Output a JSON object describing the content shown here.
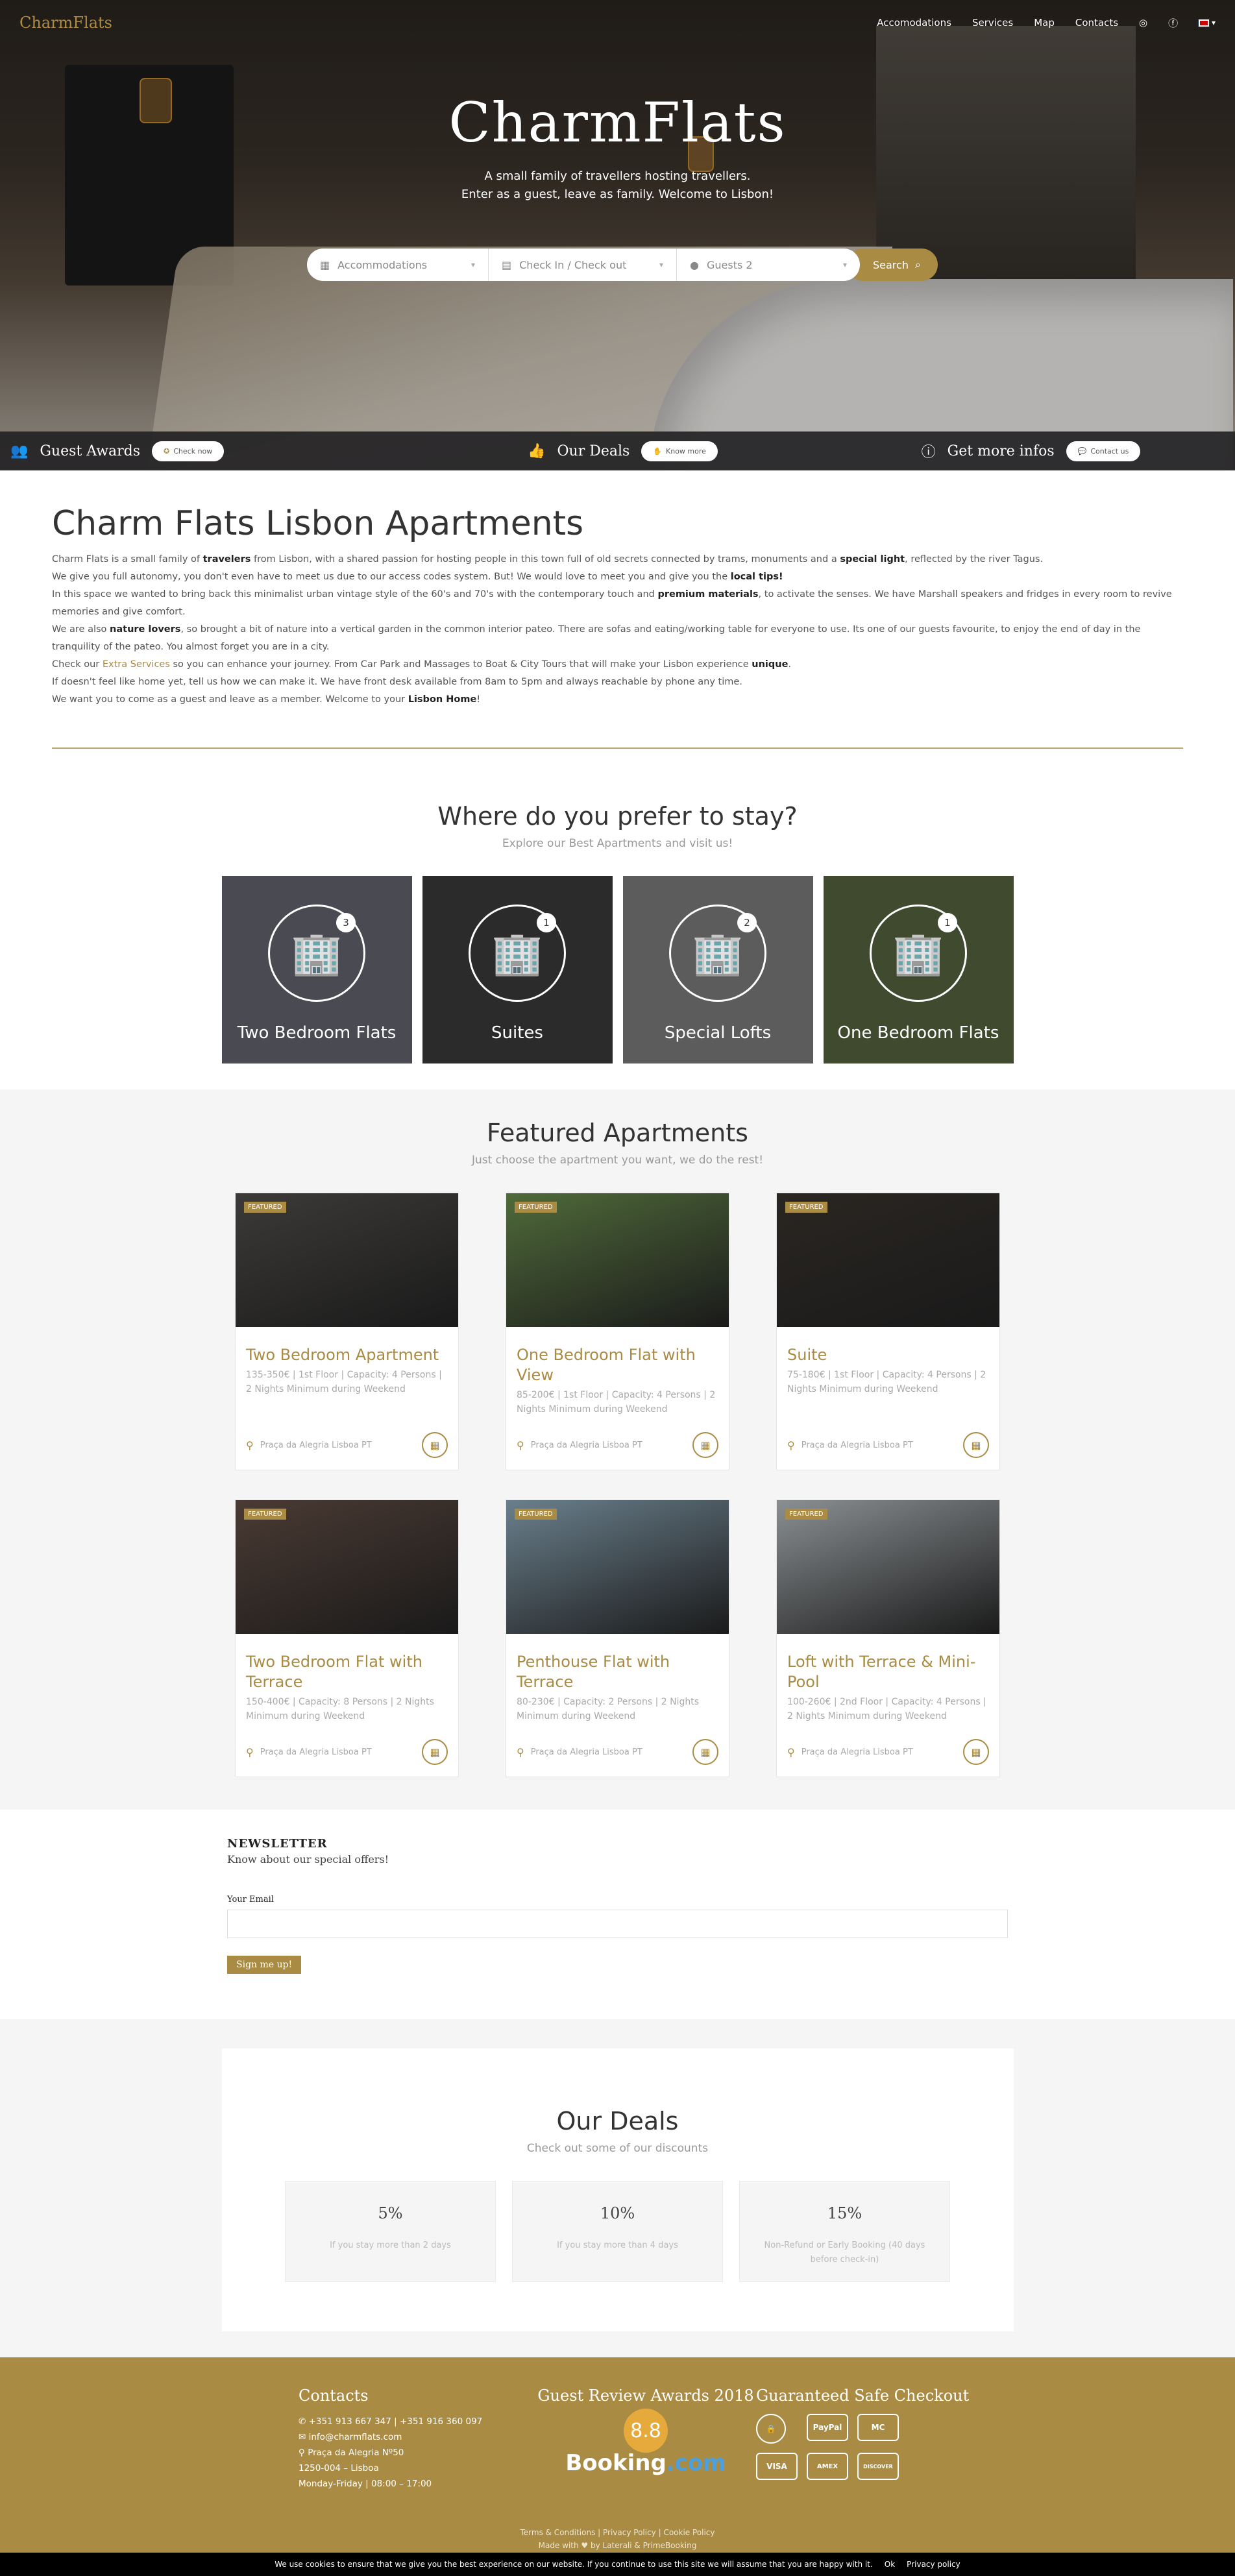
{
  "nav": {
    "logo": "CharmFlats",
    "links": [
      "Accomodations",
      "Services",
      "Map",
      "Contacts"
    ],
    "lang": "EN"
  },
  "hero": {
    "title": "CharmFlats",
    "sub1": "A small family of travellers hosting travellers.",
    "sub2": "Enter as a guest, leave as family. Welcome to Lisbon!",
    "search": {
      "accommodations": "Accommodations",
      "dates": "Check In / Check out",
      "guests": "Guests 2",
      "button": "Search"
    }
  },
  "infobar": [
    {
      "title": "Guest Awards",
      "button": "Check now",
      "icon": "users-icon"
    },
    {
      "title": "Our Deals",
      "button": "Know more",
      "icon": "thumbs-up-icon"
    },
    {
      "title": "Get more infos",
      "button": "Contact us",
      "icon": "info-icon"
    }
  ],
  "about": {
    "title": "Charm Flats Lisbon Apartments",
    "p1a": "Charm Flats is a small family of ",
    "p1b": "travelers",
    "p1c": " from Lisbon, with a shared passion for hosting people in this town full of old secrets connected by trams, monuments and a ",
    "p1d": "special light",
    "p1e": ", reflected by the river Tagus.",
    "p2a": "We give you full autonomy, you don't even have to meet us due to our access codes system. But! We would love to meet you and give you the ",
    "p2b": "local tips!",
    "p3a": "In this space we wanted to bring back this minimalist urban vintage style of the 60's and 70's with the contemporary touch and ",
    "p3b": "premium materials",
    "p3c": ", to activate the senses. We have Marshall speakers and fridges in every room to revive memories and give comfort.",
    "p4a": "We are also ",
    "p4b": "nature lovers",
    "p4c": ", so brought a bit of nature into a vertical garden in the common interior pateo. There are sofas and eating/working table for everyone to use. Its one of our guests favourite, to enjoy the end of day in the tranquility of the pateo. You almost forget you are in a city.",
    "p5a": "Check our ",
    "p5b": "Extra Services",
    "p5c": " so you can enhance your journey. From Car Park and Massages to Boat & City Tours that will make your Lisbon experience ",
    "p5d": "unique",
    "p5e": ".",
    "p6": "If doesn't feel like home yet, tell us how we can make it. We have front desk available from 8am to 5pm and always reachable by phone any time.",
    "p7a": "We want you to come as a guest and leave as a member. Welcome to your ",
    "p7b": "Lisbon Home",
    "p7c": "!"
  },
  "prefer": {
    "title": "Where do you prefer to stay?",
    "sub": "Explore our Best Apartments and visit us!",
    "cats": [
      {
        "label": "Two Bedroom Flats",
        "count": "3",
        "bg": "#4a4a52"
      },
      {
        "label": "Suites",
        "count": "1",
        "bg": "#2b2b2b"
      },
      {
        "label": "Special Lofts",
        "count": "2",
        "bg": "#5c5c5c"
      },
      {
        "label": "One Bedroom Flats",
        "count": "1",
        "bg": "#3f4a2f"
      }
    ]
  },
  "featured": {
    "title": "Featured Apartments",
    "sub": "Just choose the apartment you want, we do the rest!",
    "tag": "FEATURED",
    "location": "Praça da Alegria Lisboa PT",
    "cards": [
      {
        "title": "Two Bedroom Apartment",
        "meta": "135-350€ | 1st Floor | Capacity: 4 Persons | 2 Nights Minimum during Weekend",
        "bg": "#3c3a38"
      },
      {
        "title": "One Bedroom Flat with View",
        "meta": "85-200€ | 1st Floor | Capacity: 4 Persons | 2 Nights Minimum during Weekend",
        "bg": "#4f6a3a"
      },
      {
        "title": "Suite",
        "meta": "75-180€ | 1st Floor | Capacity: 4 Persons | 2 Nights Minimum during Weekend",
        "bg": "#2a2622"
      },
      {
        "title": "Two Bedroom Flat with Terrace",
        "meta": "150-400€ | Capacity: 8 Persons | 2 Nights Minimum during Weekend",
        "bg": "#4a3a33"
      },
      {
        "title": "Penthouse Flat with Terrace",
        "meta": "80-230€ | Capacity: 2 Persons | 2 Nights Minimum during Weekend",
        "bg": "#6a7f8c"
      },
      {
        "title": "Loft with Terrace & Mini-Pool",
        "meta": "100-260€ | 2nd Floor | Capacity: 4 Persons | 2 Nights Minimum during Weekend",
        "bg": "#8a8f92"
      }
    ]
  },
  "newsletter": {
    "title": "NEWSLETTER",
    "tag": "Know about our special offers!",
    "label": "Your Email",
    "button": "Sign me up!"
  },
  "deals": {
    "title": "Our Deals",
    "sub": "Check out some of our discounts",
    "items": [
      {
        "pct": "5%",
        "desc": "If you stay more than 2 days"
      },
      {
        "pct": "10%",
        "desc": "If you stay more than 4 days"
      },
      {
        "pct": "15%",
        "desc": "Non-Refund or Early Booking (40 days before check-in)"
      }
    ]
  },
  "footer": {
    "contacts_title": "Contacts",
    "phone": "+351 913 667 347 | +351 916 360 097",
    "email": "info@charmflats.com",
    "address1": "Praça da Alegria Nº50",
    "address2": "1250-004 – Lisboa",
    "hours": "Monday-Friday | 08:00 – 17:00",
    "awards_title": "Guest Review Awards 2018",
    "rating": "8.8",
    "booking_a": "Booking",
    "booking_b": ".com",
    "checkout_title": "Guaranteed Safe Checkout",
    "pays": [
      "🔒",
      "PayPal",
      "MC",
      "VISA",
      "AMEX",
      "DISCOVER"
    ],
    "legal": "Terms & Conditions | Privacy Policy | Cookie Policy",
    "made": "Made with ♥ by Laterali & PrimeBooking"
  },
  "cookie": {
    "text": "We use cookies to ensure that we give you the best experience on our website. If you continue to use this site we will assume that you are happy with it.",
    "ok": "Ok",
    "policy": "Privacy policy"
  }
}
